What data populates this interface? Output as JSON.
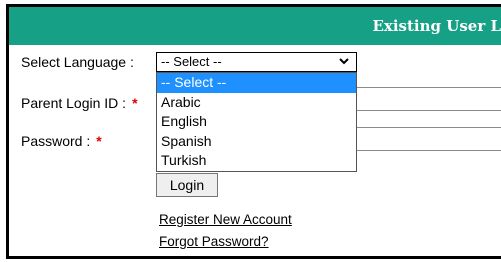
{
  "header": {
    "title": "Existing User L"
  },
  "form": {
    "language_label": "Select Language :",
    "language_selected": "-- Select --",
    "parent_id_label": "Parent Login ID :",
    "password_label": "Password :",
    "required_mark": "*",
    "login_button": "Login"
  },
  "dropdown": {
    "options": [
      "-- Select --",
      "Arabic",
      "English",
      "Spanish",
      "Turkish"
    ],
    "highlighted_index": 0
  },
  "links": {
    "register": "Register New Account",
    "forgot": "Forgot Password?"
  },
  "colors": {
    "header_bg": "#16a085",
    "highlight": "#1e90ff",
    "required": "#e00000"
  }
}
